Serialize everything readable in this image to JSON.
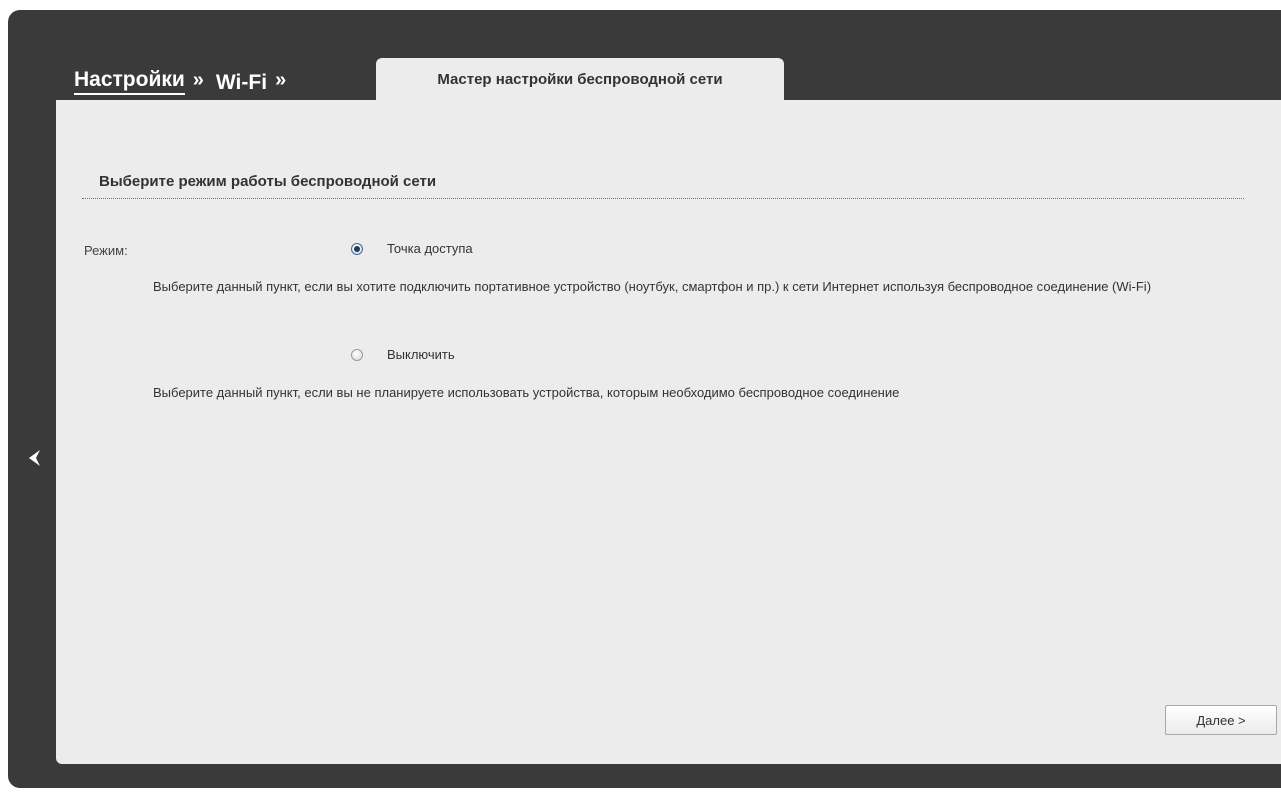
{
  "breadcrumb": {
    "settings": "Настройки",
    "sep1": "»",
    "wifi": "Wi-Fi",
    "sep2": "»"
  },
  "tab": {
    "active_label": "Мастер настройки беспроводной сети"
  },
  "section": {
    "title": "Выберите режим работы беспроводной сети"
  },
  "form": {
    "mode_label": "Режим:",
    "options": [
      {
        "label": "Точка доступа",
        "selected": true,
        "description": "Выберите данный пункт, если вы хотите подключить портативное устройство (ноутбук, смартфон и пр.) к сети Интернет используя беспроводное соединение (Wi-Fi)"
      },
      {
        "label": "Выключить",
        "selected": false,
        "description": "Выберите данный пункт, если вы не планируете использовать устройства, которым необходимо беспроводное соединение"
      }
    ]
  },
  "buttons": {
    "next_label": "Далее >"
  },
  "icons": {
    "back": "chevron-left-icon"
  }
}
